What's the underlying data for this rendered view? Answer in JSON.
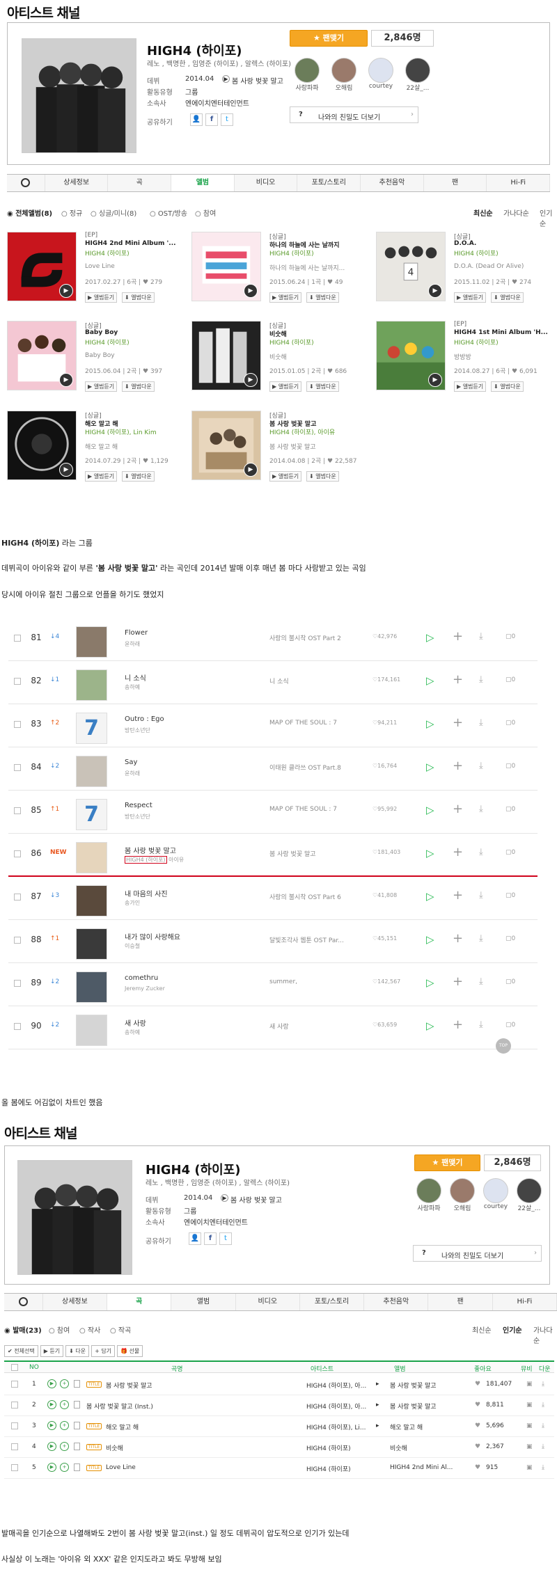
{
  "sec1": {
    "heading": "아티스트 채널",
    "name": "HIGH4 (하이포)",
    "members": "레노 , 백명한 , 임영준 (하이포) , 알렉스 (하이포)",
    "debut_label": "데뷔",
    "debut_value": "2014.04",
    "debut_song": "봄 사랑 벚꽃 말고",
    "type_label": "활동유형",
    "type_value": "그룹",
    "agency_label": "소속사",
    "agency_value": "엔에이치엔터테인먼트",
    "share_label": "공유하기",
    "fan_button": "★ 팬맺기",
    "fan_count": "2,846명",
    "fans": [
      "사랑파파",
      "오해림",
      "courtey",
      "22살_..."
    ],
    "friend_q": "?",
    "friend_label": "나와의 친밀도 더보기",
    "tabs": [
      "상세정보",
      "곡",
      "앨범",
      "비디오",
      "포토/스토리",
      "추천음악",
      "팬",
      "Hi-Fi"
    ],
    "filters": [
      "전체앨범(8)",
      "정규",
      "싱글/미니(8)",
      "OST/방송",
      "참여"
    ],
    "sorts": [
      "최신순",
      "가나다순",
      "인기순"
    ]
  },
  "albums": [
    {
      "tag": "[EP]",
      "title": "HIGH4 2nd Mini Album '...",
      "artist": "HIGH4 (하이포)",
      "track": "Love Line",
      "meta": "2017.02.27 | 6곡 | ♥ 279"
    },
    {
      "tag": "[싱글]",
      "title": "하나의 하늘에 사는 날까지",
      "artist": "HIGH4 (하이포)",
      "track": "하나의 하늘에 사는 날까지...",
      "meta": "2015.06.24 | 1곡 | ♥ 49"
    },
    {
      "tag": "[싱글]",
      "title": "D.O.A.",
      "artist": "HIGH4 (하이포)",
      "track": "D.O.A. (Dead Or Alive)",
      "meta": "2015.11.02 | 2곡 | ♥ 274"
    },
    {
      "tag": "[싱글]",
      "title": "Baby Boy",
      "artist": "HIGH4 (하이포)",
      "track": "Baby Boy",
      "meta": "2015.06.04 | 2곡 | ♥ 397"
    },
    {
      "tag": "[싱글]",
      "title": "비숫해",
      "artist": "HIGH4 (하이포)",
      "track": "비숫해",
      "meta": "2015.01.05 | 2곡 | ♥ 686"
    },
    {
      "tag": "[EP]",
      "title": "HIGH4 1st Mini Album 'H...",
      "artist": "HIGH4 (하이포)",
      "track": "방방방",
      "meta": "2014.08.27 | 6곡 | ♥ 6,091"
    },
    {
      "tag": "[싱글]",
      "title": "해오 말고 해",
      "artist": "HIGH4 (하이포), Lin Kim",
      "track": "해오 말고 해",
      "meta": "2014.07.29 | 2곡 | ♥ 1,129"
    },
    {
      "tag": "[싱글]",
      "title": "봄 사랑 벚꽃 말고",
      "artist": "HIGH4 (하이포), 아이유",
      "track": "봄 사랑 벚꽃 말고",
      "meta": "2014.04.08 | 2곡 | ♥ 22,587"
    }
  ],
  "album_btn_listen": "▶ 앨범듣기",
  "album_btn_down": "⬇ 앨범다운",
  "post1": {
    "line1_bold": "HIGH4 (하이포)",
    "line1_rest": " 라는 그룹",
    "line2_a": "데뷔곡이 아이유와 같이 부른 ",
    "line2_b": "'봄 사랑 벚꽃 말고'",
    "line2_c": " 라는 곡인데 2014년 발매 이후 매년 봄 마다 사랑받고 있는 곡임",
    "line3": "당시에 아이유 절친 그룹으로 언플을 하기도 했었지"
  },
  "chart": [
    {
      "rank": "81",
      "change": "↓4",
      "dir": "dn",
      "song": "Flower",
      "artist": "윤하래",
      "album": "사랑의 불시착 OST Part 2",
      "likes": "♡42,976"
    },
    {
      "rank": "82",
      "change": "↓1",
      "dir": "dn",
      "song": "니 소식",
      "artist": "송하예",
      "album": "니 소식",
      "likes": "♡174,161"
    },
    {
      "rank": "83",
      "change": "↑2",
      "dir": "up",
      "song": "Outro : Ego",
      "artist": "방탄소년단",
      "album": "MAP OF THE SOUL : 7",
      "likes": "♡94,211"
    },
    {
      "rank": "84",
      "change": "↓2",
      "dir": "dn",
      "song": "Say",
      "artist": "윤하래",
      "album": "이태원 클라쓰 OST Part.8",
      "likes": "♡16,764"
    },
    {
      "rank": "85",
      "change": "↑1",
      "dir": "up",
      "song": "Respect",
      "artist": "방탄소년단",
      "album": "MAP OF THE SOUL : 7",
      "likes": "♡95,992"
    },
    {
      "rank": "86",
      "change": "NEW",
      "dir": "nw",
      "song": "봄 사랑 벚꽃 말고",
      "artist": "HIGH4 (하이포)",
      "artist2": "아이유",
      "album": "봄 사랑 벚꽃 말고",
      "likes": "♡181,403"
    },
    {
      "rank": "87",
      "change": "↓3",
      "dir": "dn",
      "song": "내 마음의 사진",
      "artist": "송가인",
      "album": "사랑의 불시착 OST Part 6",
      "likes": "♡41,808"
    },
    {
      "rank": "88",
      "change": "↑1",
      "dir": "up",
      "song": "내가 많이 사랑해요",
      "artist": "이승철",
      "album": "달빛조각사 웹툰 OST Par...",
      "likes": "♡45,151"
    },
    {
      "rank": "89",
      "change": "↓2",
      "dir": "dn",
      "song": "comethru",
      "artist": "Jeremy Zucker",
      "album": "summer,",
      "likes": "♡142,567"
    },
    {
      "rank": "90",
      "change": "↓2",
      "dir": "dn",
      "song": "새 사랑",
      "artist": "송하예",
      "album": "새 사랑",
      "likes": "♡63,659"
    }
  ],
  "chart_mv": "0",
  "top_label": "TOP",
  "post2": "올 봄에도 어김없이 차트인 했음",
  "sec2": {
    "tabs_on": "곡",
    "filters": [
      "발매(23)",
      "참여",
      "작사",
      "작곡"
    ],
    "sorts": [
      "최신순",
      "인기순",
      "가나다순"
    ],
    "buttons": [
      "✔ 전체선택",
      "▶ 듣기",
      "⬇ 다운",
      "+ 담기",
      "🎁 선물"
    ],
    "head": [
      "NO",
      "곡명",
      "아티스트",
      "앨범",
      "좋아요",
      "뮤비",
      "다운"
    ],
    "songs": [
      {
        "no": "1",
        "title": "봄 사랑 벚꽃 말고",
        "artist": "HIGH4 (하이포), 아...",
        "album": "봄 사랑 벚꽃 말고",
        "likes": "181,407",
        "tag": "TITLE"
      },
      {
        "no": "2",
        "title": "봄 사랑 벚꽃 말고 (Inst.)",
        "artist": "HIGH4 (하이포), 아...",
        "album": "봄 사랑 벚꽃 말고",
        "likes": "8,811",
        "tag": ""
      },
      {
        "no": "3",
        "title": "해오 말고 해",
        "artist": "HIGH4 (하이포), Li...",
        "album": "해오 말고 해",
        "likes": "5,696",
        "tag": "TITLE"
      },
      {
        "no": "4",
        "title": "비숫해",
        "artist": "HIGH4 (하이포)",
        "album": "비숫해",
        "likes": "2,367",
        "tag": "TITLE"
      },
      {
        "no": "5",
        "title": "Love Line",
        "artist": "HIGH4 (하이포)",
        "album": "HIGH4 2nd Mini Al...",
        "likes": "915",
        "tag": "TITLE"
      }
    ]
  },
  "post3": "발매곡을 인기순으로 나열해봐도 2번이 봄 사랑 벚꽃 말고(inst.) 일 정도 데뷔곡이 압도적으로 인기가 있는데",
  "post4": "사실상 이 노래는 '아이유 외 XXX' 같은 인지도라고 봐도 무방해 보임",
  "colors": {
    "accent": "#1aa34a",
    "fan": "#f5a623",
    "highlight_line": "#d0021b"
  }
}
